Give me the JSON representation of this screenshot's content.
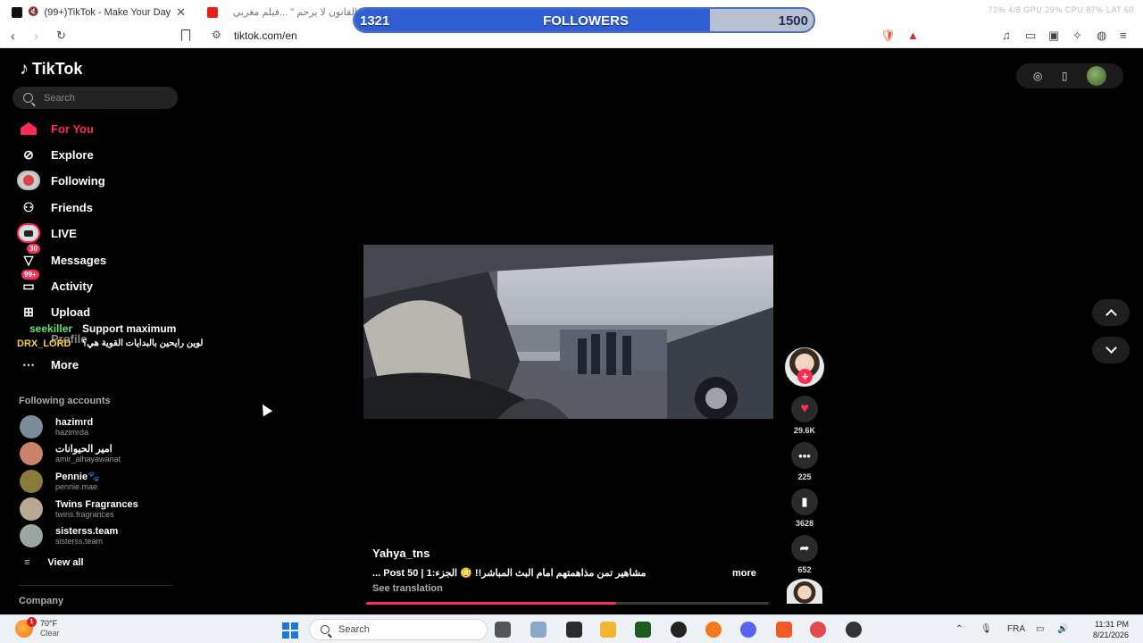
{
  "browser": {
    "tabs": [
      {
        "title": "(99+)TikTok - Make Your Day",
        "icon": "tiktok-icon",
        "muted": true
      },
      {
        "title": "القانون لا يرحم \" ...فيلم مغربي",
        "icon": "youtube-icon"
      }
    ],
    "tab_close_glyph": "✕",
    "url": "tiktok.com/en",
    "system_stats": "72% 4/8  GPU 29%  CPU 87%  LAT 60"
  },
  "followers_widget": {
    "current": 1321,
    "goal": 1500,
    "current_label": "1321",
    "goal_label": "1500",
    "title": "FOLLOWERS",
    "fill_color": "#2f5fd3",
    "track_color": "#b8c0cf"
  },
  "sidebar": {
    "logo_text": "TikTok",
    "search_placeholder": "Search",
    "nav": [
      {
        "label": "For You",
        "icon": "home-icon",
        "active": true
      },
      {
        "label": "Explore",
        "icon": "compass-icon"
      },
      {
        "label": "Following",
        "icon": "following-avatar-icon"
      },
      {
        "label": "Friends",
        "icon": "friends-icon"
      },
      {
        "label": "LIVE",
        "icon": "live-icon"
      },
      {
        "label": "Messages",
        "icon": "messages-icon",
        "badge": "30"
      },
      {
        "label": "Activity",
        "icon": "activity-icon",
        "badge": "99+"
      },
      {
        "label": "Upload",
        "icon": "upload-icon"
      },
      {
        "label": "Profile",
        "icon": "profile-icon"
      },
      {
        "label": "More",
        "icon": "more-icon"
      }
    ],
    "following_header": "Following accounts",
    "accounts": [
      {
        "name": "hazimrd",
        "handle": "hazimrda",
        "color": "#7d8a9a"
      },
      {
        "name": "امير الحيوانات",
        "handle": "amir_alhayawanat",
        "color": "#c9826b"
      },
      {
        "name": "Pennie🐾",
        "handle": "pennie.mae",
        "color": "#8a7a3c"
      },
      {
        "name": "Twins Fragrances",
        "handle": "twins.fragrances",
        "color": "#b9a98f"
      },
      {
        "name": "sisterss.team",
        "handle": "sisterss.team",
        "color": "#9aa6a0"
      }
    ],
    "view_all": "View all",
    "company": "Company"
  },
  "chat_overlay": {
    "line1_user": "seekiller",
    "line1_msg": "Support maximum",
    "line2_user": "DRX_LORD",
    "line2_msg": "لوين رايحين بالبدايات القوية هي؟"
  },
  "top_right": {
    "icons": [
      "eye-off-icon",
      "tablet-icon",
      "user-avatar-icon"
    ]
  },
  "video": {
    "creator": "Yahya_tns",
    "caption": "مشاهير تمن مذاهمتهم امام البث المباشر!! 😳 الجزء:1 | Post 50 ...",
    "more": "more",
    "see_translation": "See translation",
    "progress": 0.62
  },
  "actions": {
    "likes": "29.6K",
    "comments": "225",
    "saves": "3628",
    "shares": "652",
    "follow_plus": "+"
  },
  "taskbar": {
    "weather_temp": "70°F",
    "weather_cond": "Clear",
    "weather_badge": "1",
    "search_placeholder": "Search",
    "language": "FRA",
    "time": "11:31 PM",
    "date": "8/21/2026"
  }
}
